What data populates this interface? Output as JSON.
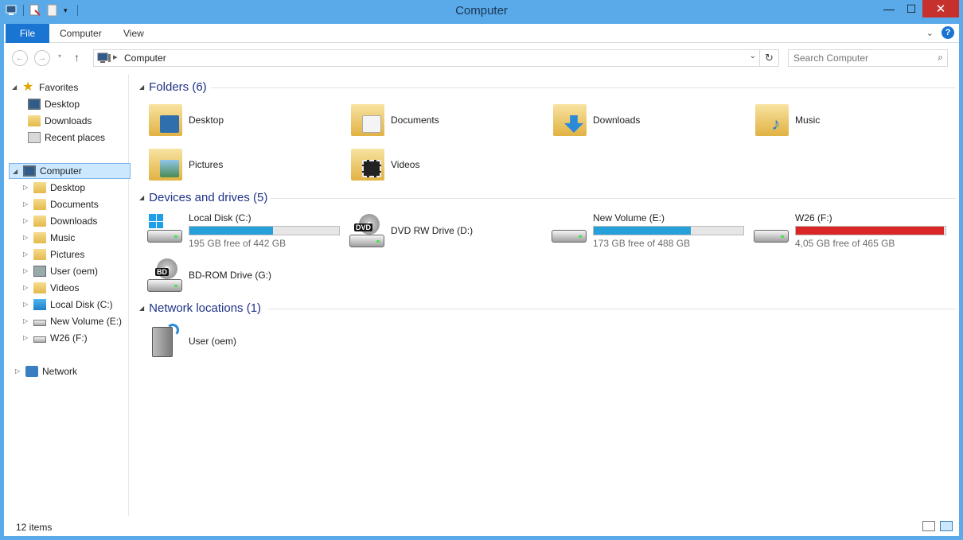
{
  "window": {
    "title": "Computer",
    "titlebar_color": "#5aa9e9",
    "controls": {
      "minimize": "—",
      "maximize": "☐",
      "close": "✕"
    }
  },
  "ribbon": {
    "file_label": "File",
    "tabs": [
      "Computer",
      "View"
    ],
    "accent": "#1a74d1",
    "help_label": "?"
  },
  "navigation": {
    "back_icon": "back-arrow-icon",
    "forward_icon": "forward-arrow-icon",
    "up_icon": "up-arrow-icon",
    "breadcrumb": "Computer",
    "search_placeholder": "Search Computer"
  },
  "sidebar": {
    "favorites": {
      "label": "Favorites",
      "items": [
        "Desktop",
        "Downloads",
        "Recent places"
      ]
    },
    "computer": {
      "label": "Computer",
      "items": [
        "Desktop",
        "Documents",
        "Downloads",
        "Music",
        "Pictures",
        "User (oem)",
        "Videos",
        "Local Disk (C:)",
        "New Volume (E:)",
        "W26 (F:)"
      ]
    },
    "network": {
      "label": "Network"
    }
  },
  "groups": {
    "folders": {
      "header": "Folders (6)",
      "items": [
        "Desktop",
        "Documents",
        "Downloads",
        "Music",
        "Pictures",
        "Videos"
      ]
    },
    "drives": {
      "header": "Devices and drives (5)",
      "items": [
        {
          "name": "Local Disk (C:)",
          "free": "195 GB free of 442 GB",
          "used_fraction": 0.56,
          "full_warning": false
        },
        {
          "name": "DVD RW Drive (D:)",
          "tag": "DVD"
        },
        {
          "name": "New Volume (E:)",
          "free": "173 GB free of 488 GB",
          "used_fraction": 0.65,
          "full_warning": false
        },
        {
          "name": "W26 (F:)",
          "free": "4,05 GB free of 465 GB",
          "used_fraction": 0.99,
          "full_warning": true
        },
        {
          "name": "BD-ROM Drive (G:)",
          "tag": "BD"
        }
      ]
    },
    "network": {
      "header": "Network locations (1)",
      "items": [
        "User (oem)"
      ]
    }
  },
  "status": {
    "item_count": "12 items"
  }
}
